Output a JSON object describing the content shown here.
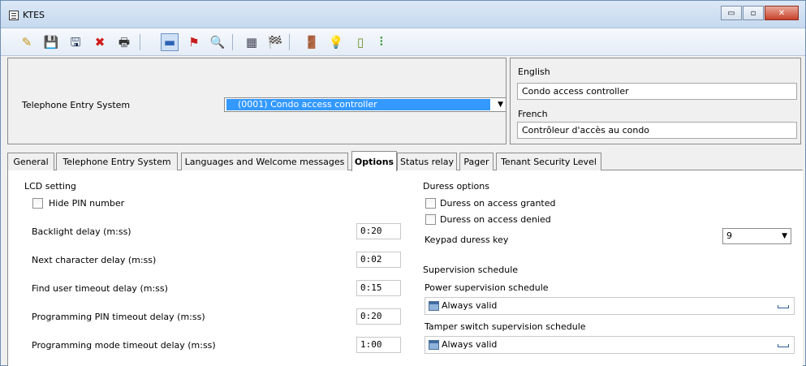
{
  "window": {
    "title": "KTES",
    "minimize": "▭",
    "maximize": "▫",
    "close": "✕"
  },
  "toolbar": {
    "icons": [
      "new-icon",
      "save-icon",
      "save-all-icon",
      "delete-icon",
      "print-icon",
      "view-icon",
      "structure-icon",
      "search-icon",
      "report-icon",
      "event-icon",
      "door-icon",
      "light-icon",
      "panel-icon",
      "status-icon"
    ],
    "glyphs": {
      "new": "✎",
      "save": "💾",
      "save_all": "🖫",
      "delete": "✖",
      "print": "🖶",
      "view": "▬",
      "structure": "⚑",
      "search": "🔍",
      "report": "▦",
      "events": "🏁",
      "door": "🚪",
      "light": "💡",
      "panel": "▯",
      "status": "⠇"
    }
  },
  "header": {
    "tes_label": "Telephone Entry System",
    "tes_selected": "(0001) Condo access controller",
    "english_label": "English",
    "english_value": "Condo access controller",
    "french_label": "French",
    "french_value": "Contrôleur d'accès au condo"
  },
  "tabs": [
    "General",
    "Telephone Entry System",
    "Languages and Welcome messages",
    "Options",
    "Status relay",
    "Pager",
    "Tenant Security Level"
  ],
  "selected_tab": "Options",
  "options": {
    "lcd_setting": "LCD setting",
    "hide_pin": "Hide PIN number",
    "hide_pin_checked": false,
    "backlight_label": "Backlight delay (m:ss)",
    "backlight_value": "0:20",
    "next_char_label": "Next character delay (m:ss)",
    "next_char_value": "0:02",
    "find_user_label": "Find user timeout delay (m:ss)",
    "find_user_value": "0:15",
    "prog_pin_label": "Programming PIN timeout delay (m:ss)",
    "prog_pin_value": "0:20",
    "prog_mode_label": "Programming mode timeout delay (m:ss)",
    "prog_mode_value": "1:00"
  },
  "duress": {
    "section": "Duress options",
    "granted": "Duress on access granted",
    "granted_checked": false,
    "denied": "Duress on access denied",
    "denied_checked": false,
    "keypad_label": "Keypad duress key",
    "keypad_value": "9"
  },
  "supervision": {
    "section": "Supervision schedule",
    "power_label": "Power supervision schedule",
    "power_value": "Always valid",
    "tamper_label": "Tamper switch supervision schedule",
    "tamper_value": "Always valid"
  }
}
